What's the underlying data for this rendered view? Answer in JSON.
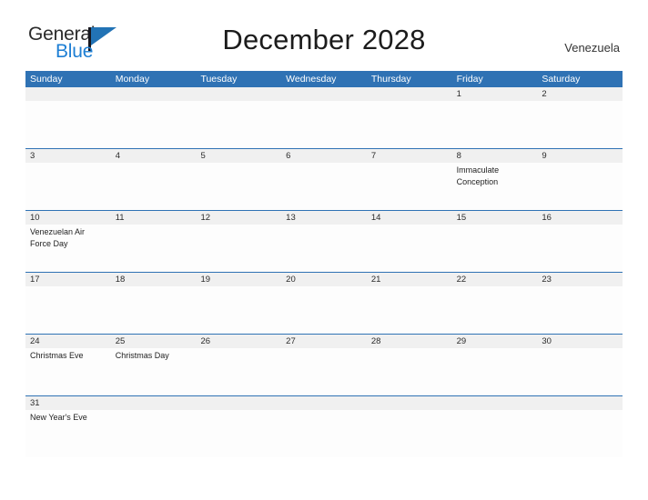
{
  "brand": {
    "name_part1": "General",
    "name_part2": "Blue",
    "accent_color": "#1e7fd4",
    "flag_color": "#2273b5"
  },
  "header": {
    "title": "December 2028",
    "region": "Venezuela"
  },
  "theme": {
    "header_blue": "#2f72b4",
    "date_strip_gray": "#f0f0f0",
    "body_white": "#fdfdfd",
    "text_color": "#1f1f1f"
  },
  "calendar": {
    "weekdays": [
      {
        "label": "Sunday"
      },
      {
        "label": "Monday"
      },
      {
        "label": "Tuesday"
      },
      {
        "label": "Wednesday"
      },
      {
        "label": "Thursday"
      },
      {
        "label": "Friday"
      },
      {
        "label": "Saturday"
      }
    ],
    "weeks": [
      {
        "days": [
          {
            "date": "",
            "events": []
          },
          {
            "date": "",
            "events": []
          },
          {
            "date": "",
            "events": []
          },
          {
            "date": "",
            "events": []
          },
          {
            "date": "",
            "events": []
          },
          {
            "date": "1",
            "events": []
          },
          {
            "date": "2",
            "events": []
          }
        ]
      },
      {
        "days": [
          {
            "date": "3",
            "events": []
          },
          {
            "date": "4",
            "events": []
          },
          {
            "date": "5",
            "events": []
          },
          {
            "date": "6",
            "events": []
          },
          {
            "date": "7",
            "events": []
          },
          {
            "date": "8",
            "events": [
              "Immaculate Conception"
            ]
          },
          {
            "date": "9",
            "events": []
          }
        ]
      },
      {
        "days": [
          {
            "date": "10",
            "events": [
              "Venezuelan Air Force Day"
            ]
          },
          {
            "date": "11",
            "events": []
          },
          {
            "date": "12",
            "events": []
          },
          {
            "date": "13",
            "events": []
          },
          {
            "date": "14",
            "events": []
          },
          {
            "date": "15",
            "events": []
          },
          {
            "date": "16",
            "events": []
          }
        ]
      },
      {
        "days": [
          {
            "date": "17",
            "events": []
          },
          {
            "date": "18",
            "events": []
          },
          {
            "date": "19",
            "events": []
          },
          {
            "date": "20",
            "events": []
          },
          {
            "date": "21",
            "events": []
          },
          {
            "date": "22",
            "events": []
          },
          {
            "date": "23",
            "events": []
          }
        ]
      },
      {
        "days": [
          {
            "date": "24",
            "events": [
              "Christmas Eve"
            ]
          },
          {
            "date": "25",
            "events": [
              "Christmas Day"
            ]
          },
          {
            "date": "26",
            "events": []
          },
          {
            "date": "27",
            "events": []
          },
          {
            "date": "28",
            "events": []
          },
          {
            "date": "29",
            "events": []
          },
          {
            "date": "30",
            "events": []
          }
        ]
      },
      {
        "days": [
          {
            "date": "31",
            "events": [
              "New Year's Eve"
            ]
          },
          {
            "date": "",
            "events": []
          },
          {
            "date": "",
            "events": []
          },
          {
            "date": "",
            "events": []
          },
          {
            "date": "",
            "events": []
          },
          {
            "date": "",
            "events": []
          },
          {
            "date": "",
            "events": []
          }
        ]
      }
    ]
  }
}
